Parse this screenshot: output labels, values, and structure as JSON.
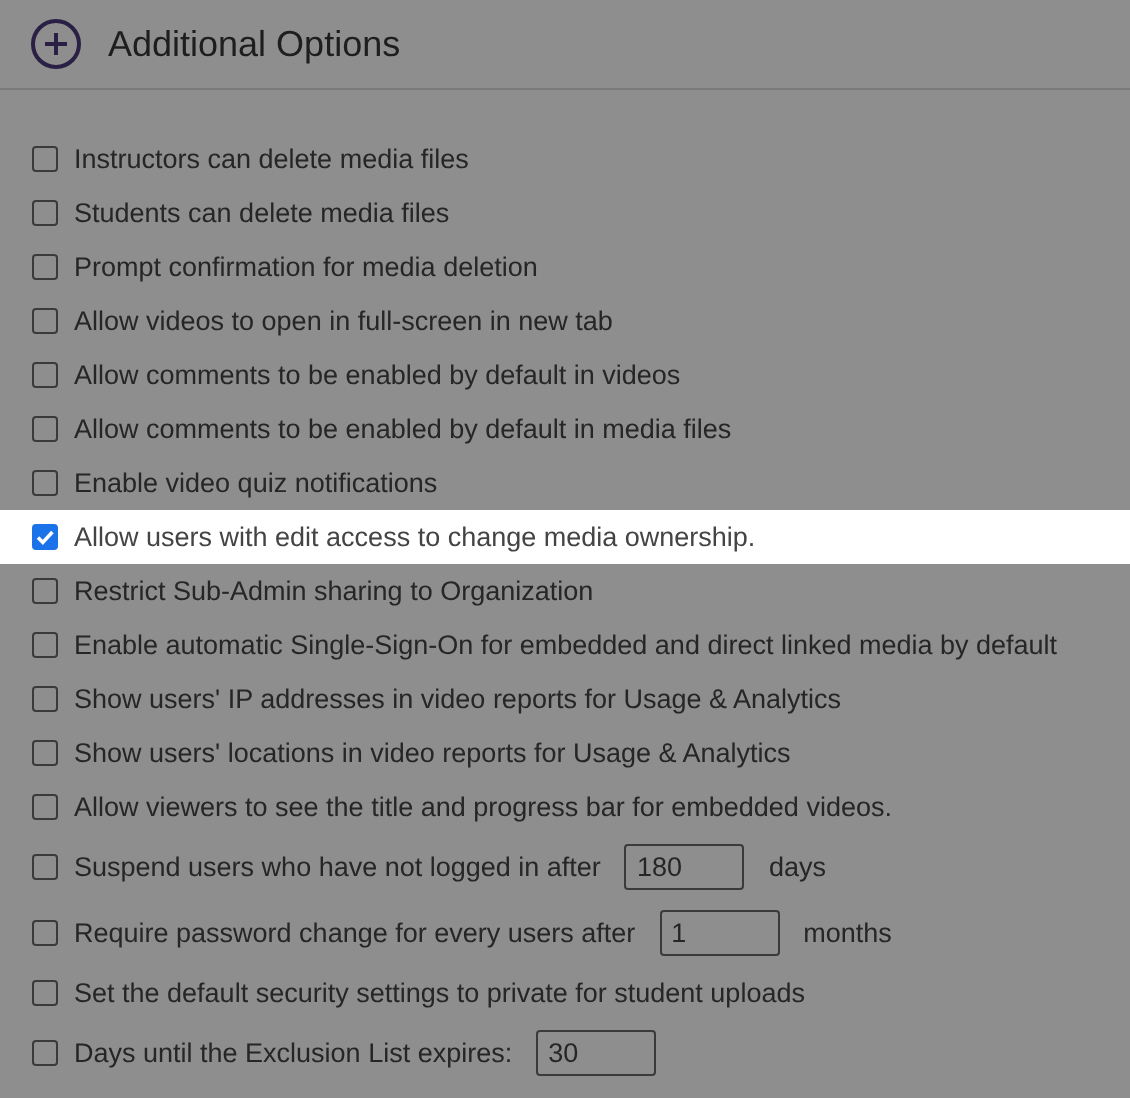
{
  "section": {
    "title": "Additional Options"
  },
  "options": [
    {
      "kind": "check",
      "label": "Instructors can delete media files",
      "checked": false,
      "highlighted": false
    },
    {
      "kind": "check",
      "label": "Students can delete media files",
      "checked": false,
      "highlighted": false
    },
    {
      "kind": "check",
      "label": "Prompt confirmation for media deletion",
      "checked": false,
      "highlighted": false
    },
    {
      "kind": "check",
      "label": "Allow videos to open in full-screen in new tab",
      "checked": false,
      "highlighted": false
    },
    {
      "kind": "check",
      "label": "Allow comments to be enabled by default in videos",
      "checked": false,
      "highlighted": false
    },
    {
      "kind": "check",
      "label": "Allow comments to be enabled by default in media files",
      "checked": false,
      "highlighted": false
    },
    {
      "kind": "check",
      "label": "Enable video quiz notifications",
      "checked": false,
      "highlighted": false
    },
    {
      "kind": "check",
      "label": "Allow users with edit access to change media ownership.",
      "checked": true,
      "highlighted": true
    },
    {
      "kind": "check",
      "label": "Restrict Sub-Admin sharing to Organization",
      "checked": false,
      "highlighted": false
    },
    {
      "kind": "check",
      "label": "Enable automatic Single-Sign-On for embedded and direct linked media by default",
      "checked": false,
      "highlighted": false
    },
    {
      "kind": "check",
      "label": "Show users' IP addresses in video reports for Usage & Analytics",
      "checked": false,
      "highlighted": false
    },
    {
      "kind": "check",
      "label": "Show users' locations in video reports for Usage & Analytics",
      "checked": false,
      "highlighted": false
    },
    {
      "kind": "check",
      "label": "Allow viewers to see the title and progress bar for embedded videos.",
      "checked": false,
      "highlighted": false
    },
    {
      "kind": "input",
      "label": "Suspend users who have not logged in after",
      "value": "180",
      "suffix": "days",
      "checked": false,
      "highlighted": false
    },
    {
      "kind": "input",
      "label": "Require password change for every users after",
      "value": "1",
      "suffix": "months",
      "checked": false,
      "highlighted": false
    },
    {
      "kind": "check",
      "label": "Set the default security settings to private for student uploads",
      "checked": false,
      "highlighted": false
    },
    {
      "kind": "input",
      "label": "Days until the Exclusion List expires:",
      "value": "30",
      "checked": false,
      "highlighted": false
    }
  ]
}
